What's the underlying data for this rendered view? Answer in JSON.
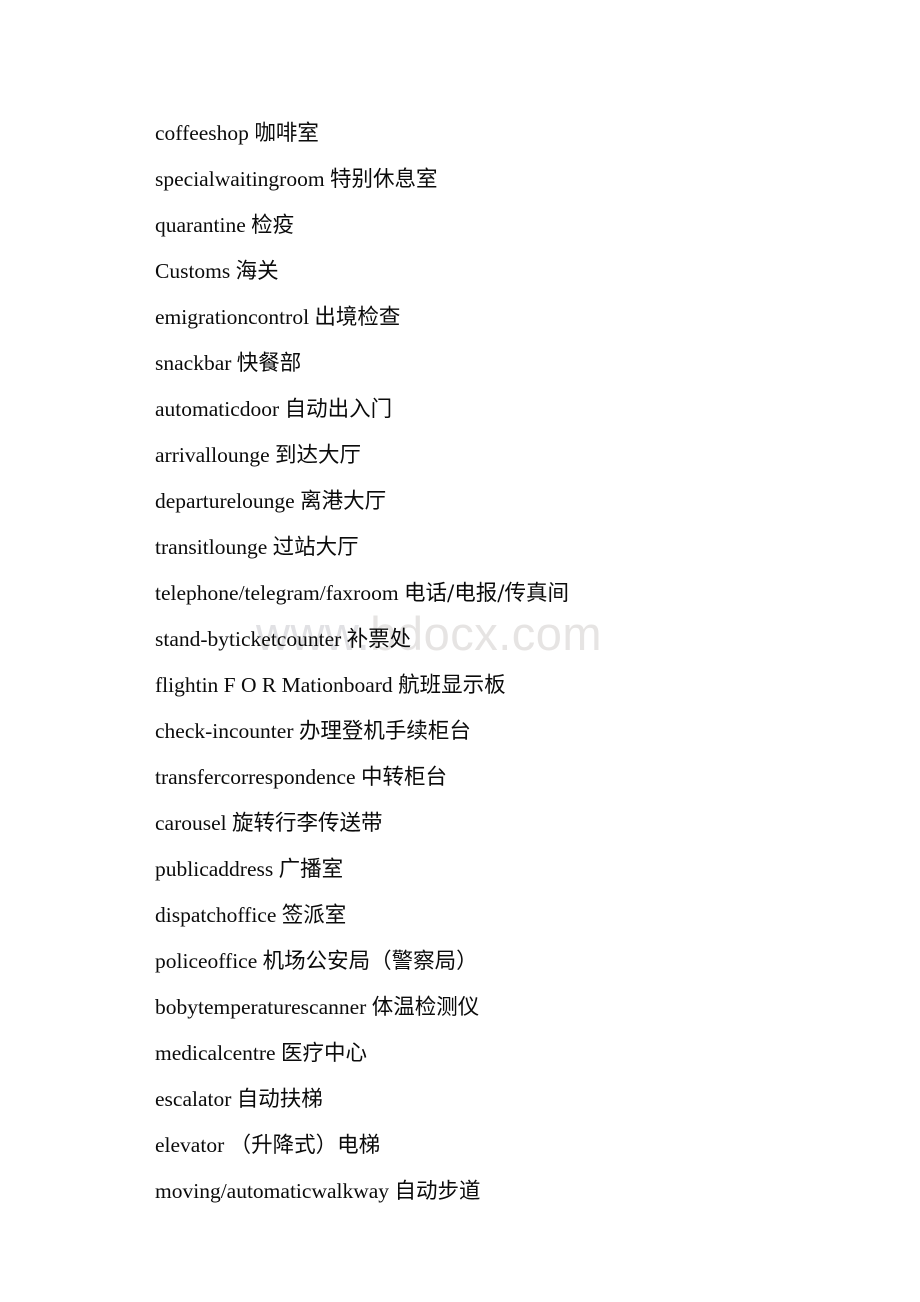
{
  "document": {
    "type": "text-document",
    "page_background": "#ffffff",
    "text_color": "#000000",
    "watermark": {
      "part_one": "www.",
      "part_two": "bdocx.com",
      "full_text": "www.bdocx.com",
      "color_part_one": "#e1e1e4",
      "color_part_two": "#e6e4e3"
    },
    "lines": [
      {
        "index": 1,
        "term": "coffeeshop",
        "gloss": "咖啡室"
      },
      {
        "index": 2,
        "term": "specialwaitingroom",
        "gloss": "特别休息室"
      },
      {
        "index": 3,
        "term": "quarantine",
        "gloss": "检疫"
      },
      {
        "index": 4,
        "term": "Customs",
        "gloss": "海关"
      },
      {
        "index": 5,
        "term": "emigrationcontrol",
        "gloss": "出境检查"
      },
      {
        "index": 6,
        "term": "snackbar",
        "gloss": "快餐部"
      },
      {
        "index": 7,
        "term": "automaticdoor",
        "gloss": "自动出入门"
      },
      {
        "index": 8,
        "term": "arrivallounge",
        "gloss": "到达大厅"
      },
      {
        "index": 9,
        "term": "departurelounge",
        "gloss": "离港大厅"
      },
      {
        "index": 10,
        "term": "transitlounge",
        "gloss": "过站大厅"
      },
      {
        "index": 11,
        "term": "telephone/telegram/faxroom",
        "gloss": "电话/电报/传真间"
      },
      {
        "index": 12,
        "term": "stand-byticketcounter",
        "gloss": "补票处"
      },
      {
        "index": 13,
        "term": "flightin F O R Mationboard",
        "gloss": "航班显示板"
      },
      {
        "index": 14,
        "term": "check-incounter",
        "gloss": "办理登机手续柜台"
      },
      {
        "index": 15,
        "term": "transfercorrespondence",
        "gloss": "中转柜台"
      },
      {
        "index": 16,
        "term": "carousel",
        "gloss": "旋转行李传送带"
      },
      {
        "index": 17,
        "term": "publicaddress",
        "gloss": "广播室"
      },
      {
        "index": 18,
        "term": "dispatchoffice",
        "gloss": "签派室"
      },
      {
        "index": 19,
        "term": "policeoffice",
        "gloss": "机场公安局（警察局）"
      },
      {
        "index": 20,
        "term": "bobytemperaturescanner",
        "gloss": "体温检测仪"
      },
      {
        "index": 21,
        "term": "medicalcentre",
        "gloss": "医疗中心"
      },
      {
        "index": 22,
        "term": "escalator",
        "gloss": "自动扶梯"
      },
      {
        "index": 23,
        "term": "elevator",
        "gloss": "（升降式）电梯"
      },
      {
        "index": 24,
        "term": "moving/automaticwalkway",
        "gloss": "自动步道"
      }
    ]
  }
}
